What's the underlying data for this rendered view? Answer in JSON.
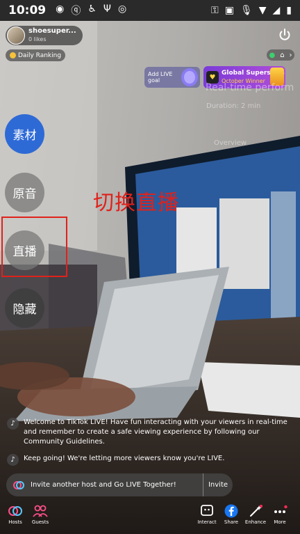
{
  "status_bar": {
    "time": "10:09"
  },
  "host": {
    "name": "shoesuper...",
    "likes": "0 likes"
  },
  "ranking": {
    "label": "Daily Ranking"
  },
  "promo": {
    "add_goal": "Add LIVE goal",
    "superstar_title": "Global Superstars",
    "superstar_sub": "October Winner"
  },
  "background_text": {
    "realtime": "Real-time perform",
    "duration": "Duration: 2 min",
    "overview": "Overview"
  },
  "side_buttons": {
    "sucai": "素材",
    "yuanyin": "原音",
    "zhibo": "直播",
    "yincang": "隐藏"
  },
  "annotation": {
    "text": "切换直播",
    "color": "#e0211b"
  },
  "messages": {
    "welcome": "Welcome to TikTok LIVE! Have fun interacting with your viewers in real-time and remember to create a safe viewing experience by following our Community Guidelines.",
    "keep_going": "Keep going! We're letting more viewers know you're LIVE."
  },
  "invite": {
    "text": "Invite another host and Go LIVE Together!",
    "button": "Invite"
  },
  "bottom_bar": {
    "hosts": "Hosts",
    "guests": "Guests",
    "interact": "Interact",
    "share": "Share",
    "enhance": "Enhance",
    "more": "More"
  },
  "icons": [
    "power-icon",
    "shield-icon",
    "home-icon",
    "tiktok-note-icon",
    "hosts-icon",
    "guests-icon",
    "interact-icon",
    "facebook-icon",
    "enhance-icon",
    "more-icon"
  ]
}
